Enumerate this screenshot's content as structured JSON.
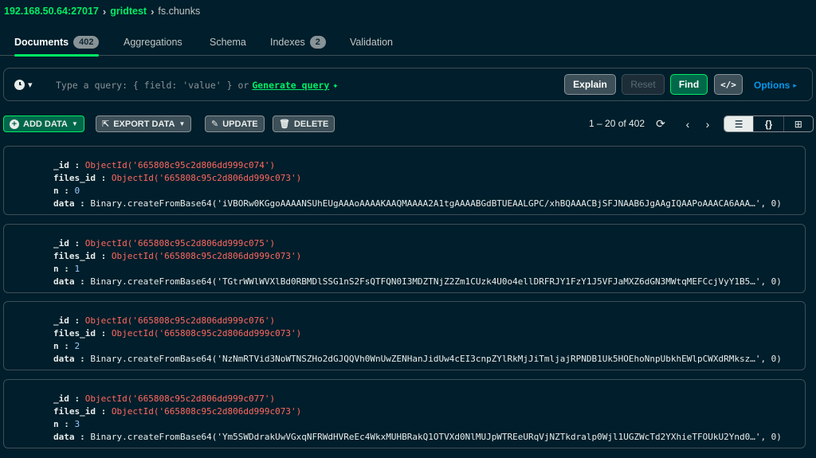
{
  "breadcrumb": {
    "host": "192.168.50.64:27017",
    "database": "gridtest",
    "collection": "fs.chunks"
  },
  "tabs": [
    {
      "label": "Documents",
      "badge": "402",
      "active": true
    },
    {
      "label": "Aggregations"
    },
    {
      "label": "Schema"
    },
    {
      "label": "Indexes",
      "badge": "2"
    },
    {
      "label": "Validation"
    }
  ],
  "query": {
    "placeholder": "Type a query: { field: 'value' } or",
    "generate_label": "Generate query",
    "explain": "Explain",
    "reset": "Reset",
    "find": "Find",
    "code": "</>",
    "options": "Options"
  },
  "toolbar": {
    "add_data": "ADD DATA",
    "export_data": "EXPORT DATA",
    "update": "UPDATE",
    "delete": "DELETE",
    "pagination": "1 – 20 of 402"
  },
  "documents": [
    {
      "id_key": "_id",
      "id": "ObjectId('665808c95c2d806dd999c074')",
      "files_id_key": "files_id",
      "files_id": "ObjectId('665808c95c2d806dd999c073')",
      "n_key": "n",
      "n": "0",
      "data_key": "data",
      "data": "Binary.createFromBase64('iVBORw0KGgoAAAANSUhEUgAAAoAAAAKAAQMAAAA2A1tgAAAABGdBTUEAALGPC/xhBQAAACBjSFJNAAB6JgAAgIQAAPoAAACA6AAA…', 0)"
    },
    {
      "id_key": "_id",
      "id": "ObjectId('665808c95c2d806dd999c075')",
      "files_id_key": "files_id",
      "files_id": "ObjectId('665808c95c2d806dd999c073')",
      "n_key": "n",
      "n": "1",
      "data_key": "data",
      "data": "Binary.createFromBase64('TGtrWWlWVXlBd0RBMDlSSG1nS2FsQTFQN0I3MDZTNjZ2Zm1CUzk4U0o4ellDRFRJY1FzY1J5VFJaMXZ6dGN3MWtqMEFCcjVyY1B5…', 0)"
    },
    {
      "id_key": "_id",
      "id": "ObjectId('665808c95c2d806dd999c076')",
      "files_id_key": "files_id",
      "files_id": "ObjectId('665808c95c2d806dd999c073')",
      "n_key": "n",
      "n": "2",
      "data_key": "data",
      "data": "Binary.createFromBase64('NzNmRTVid3NoWTNSZHo2dGJQQVh0WnUwZENHanJidUw4cEI3cnpZYlRkMjJiTmljajRPNDB1Uk5HOEhoNnpUbkhEWlpCWXdRMksz…', 0)"
    },
    {
      "id_key": "_id",
      "id": "ObjectId('665808c95c2d806dd999c077')",
      "files_id_key": "files_id",
      "files_id": "ObjectId('665808c95c2d806dd999c073')",
      "n_key": "n",
      "n": "3",
      "data_key": "data",
      "data": "Binary.createFromBase64('Ym5SWDdrakUwVGxqNFRWdHVReEc4WkxMUHBRakQ1OTVXd0NlMUJpWTREeURqVjNZTkdralp0Wjl1UGZWcTd2YXhieTFOUkU2Ynd0…', 0)"
    }
  ],
  "colors": {
    "background": "#001e2b",
    "accent_green": "#00ed64",
    "objectid_red": "#ff6960",
    "number_blue": "#9dcbff",
    "link_blue": "#0498ec"
  }
}
